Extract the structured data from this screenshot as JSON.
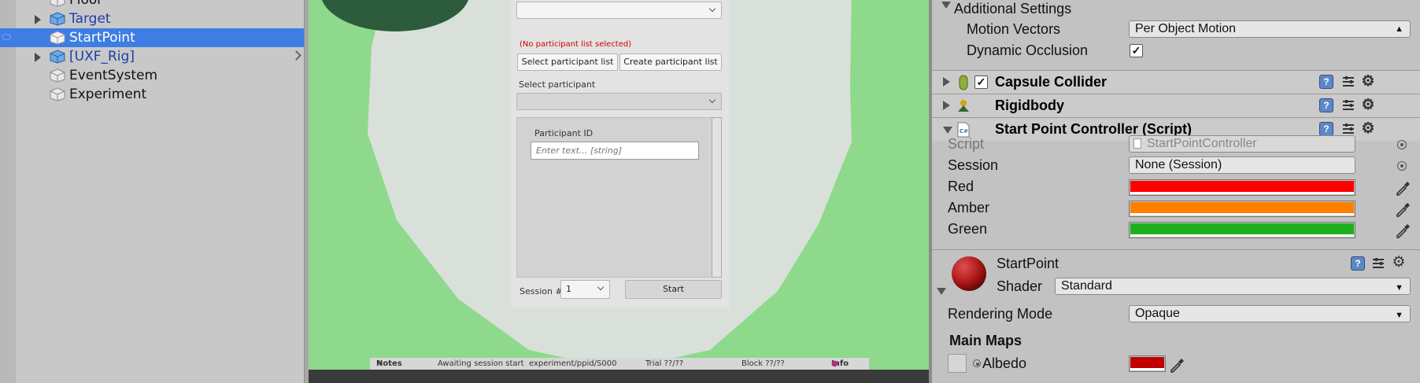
{
  "hierarchy": {
    "items": [
      {
        "label": "Floor",
        "type": "plain"
      },
      {
        "label": "Target",
        "type": "prefab"
      },
      {
        "label": "StartPoint",
        "type": "selected"
      },
      {
        "label": "[UXF_Rig]",
        "type": "prefab"
      },
      {
        "label": "EventSystem",
        "type": "plain"
      },
      {
        "label": "Experiment",
        "type": "plain"
      }
    ]
  },
  "game": {
    "error_text": "(No participant list selected)",
    "select_list_button": "Select participant list",
    "create_list_button": "Create participant list",
    "select_participant_label": "Select participant",
    "participant_id_label": "Participant ID",
    "participant_id_placeholder": "Enter text... [string]",
    "session_label": "Session #",
    "session_value": "1",
    "start_button": "Start",
    "status": {
      "notes": "Notes",
      "awaiting": "Awaiting session start",
      "path": "experiment/ppid/S000",
      "trial": "Trial ??/??",
      "block": "Block ??/??",
      "info": "Info"
    }
  },
  "inspector": {
    "additional_settings": "Additional Settings",
    "motion_vectors_label": "Motion Vectors",
    "motion_vectors_value": "Per Object Motion",
    "dynamic_occlusion_label": "Dynamic Occlusion",
    "capsule_collider": "Capsule Collider",
    "rigidbody": "Rigidbody",
    "start_point_controller": "Start Point Controller (Script)",
    "script_label": "Script",
    "script_value": "StartPointController",
    "session_label": "Session",
    "session_value": "None (Session)",
    "red_label": "Red",
    "amber_label": "Amber",
    "green_label": "Green",
    "material_name": "StartPoint",
    "shader_label": "Shader",
    "shader_value": "Standard",
    "rendering_mode_label": "Rendering Mode",
    "rendering_mode_value": "Opaque",
    "main_maps_label": "Main Maps",
    "albedo_label": "Albedo",
    "colors": {
      "red": "#ff0000",
      "amber": "#ff8000",
      "green": "#1db21d",
      "albedo": "#c00000"
    }
  }
}
